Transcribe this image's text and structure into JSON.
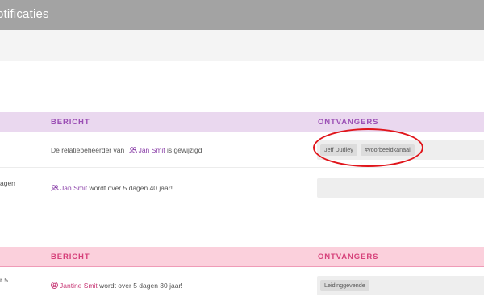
{
  "window": {
    "title": "otificaties"
  },
  "colors": {
    "titlebar": "#a3a3a3",
    "section1_header": "#ead8ef",
    "section1_accent": "#9b4fb5",
    "section2_header": "#fbd0dc",
    "section2_accent": "#d6417a",
    "link_purple": "#8a3fa8",
    "link_pink": "#c83c78",
    "annotation": "#e0151b"
  },
  "section1": {
    "columns": {
      "message": "BERICHT",
      "recipients": "ONTVANGERS"
    },
    "rows": [
      {
        "left_text": "",
        "message_before": "De relatiebeheerder van",
        "contact": "Jan Smit",
        "contact_icon": "users-icon",
        "message_after": "is gewijzigd",
        "recipients": [
          "Jeff Dudley",
          "#voorbeeldkanaal"
        ]
      },
      {
        "left_text": "agen",
        "message_before": "",
        "contact": "Jan Smit",
        "contact_icon": "users-icon",
        "message_after": "wordt over 5 dagen 40 jaar!",
        "recipients": []
      }
    ]
  },
  "section2": {
    "columns": {
      "message": "BERICHT",
      "recipients": "ONTVANGERS"
    },
    "rows": [
      {
        "left_text": "r 5",
        "contact": "Jantine Smit",
        "contact_icon": "user-circle-icon",
        "message_after": "wordt over 5 dagen 30 jaar!",
        "recipients": [
          "Leidinggevende"
        ]
      }
    ]
  }
}
